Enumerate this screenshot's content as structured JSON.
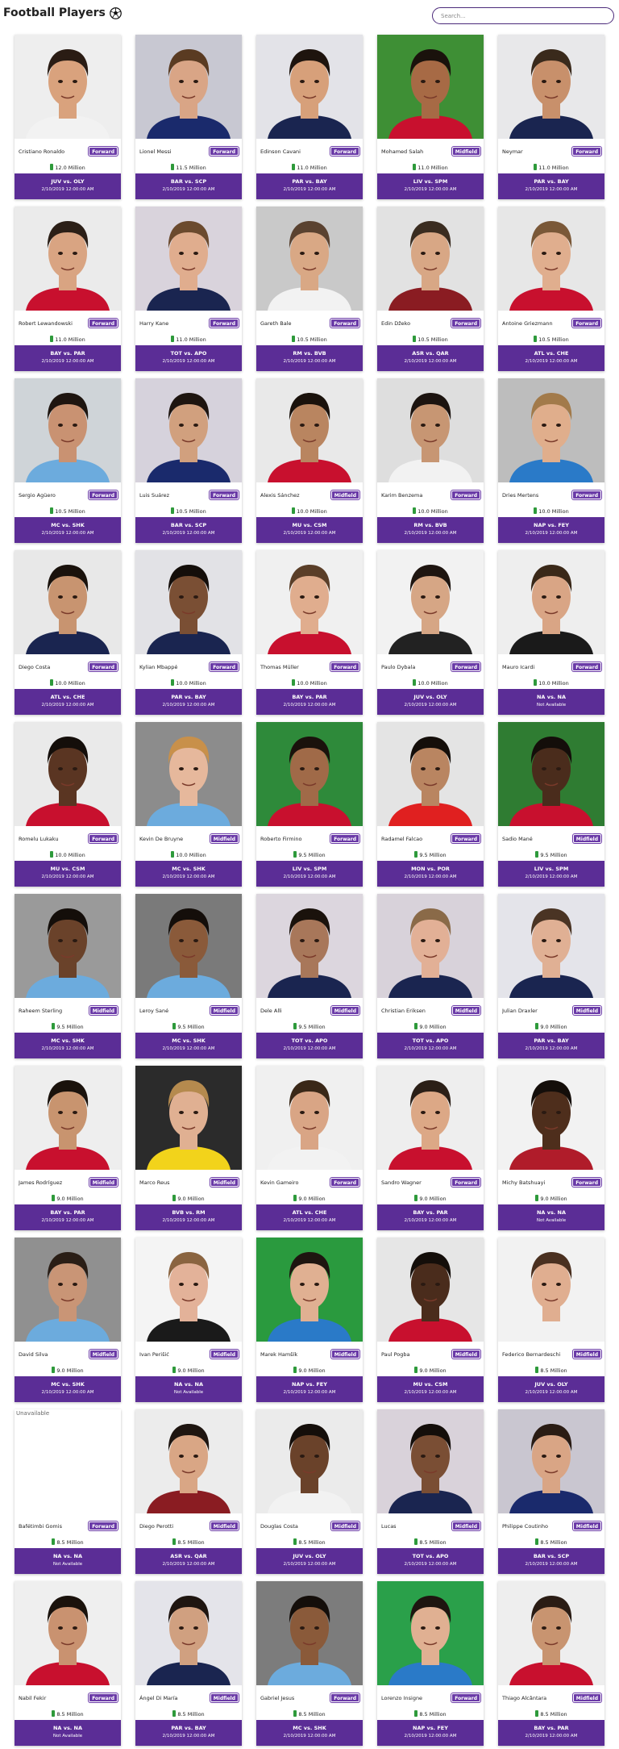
{
  "header": {
    "title": "Football Players",
    "search_placeholder": "Search..."
  },
  "colors": {
    "accent": "#5b2d96",
    "badge": "#6a3aa7",
    "money": "#2e9a3b"
  },
  "icons": {
    "ball": "soccer-ball-icon",
    "money": "money-icon"
  },
  "unavailable_alt": "Unavailable",
  "players": [
    {
      "name": "Cristiano Ronaldo",
      "position": "Forward",
      "value": "12.0 Million",
      "match": "JUV vs. OLY",
      "date": "2/10/2019 12:00:00 AM",
      "bg": "#eeeeee",
      "skin": "#d9a27d",
      "hair": "#2a1c14",
      "shirt": "#f2f2f2"
    },
    {
      "name": "Lionel Messi",
      "position": "Forward",
      "value": "11.5 Million",
      "match": "BAR vs. SCP",
      "date": "2/10/2019 12:00:00 AM",
      "bg": "#c8c8d2",
      "skin": "#d9a586",
      "hair": "#5a3b22",
      "shirt": "#1a2a6c"
    },
    {
      "name": "Edinson Cavani",
      "position": "Forward",
      "value": "11.0 Million",
      "match": "PAR vs. BAY",
      "date": "2/10/2019 12:00:00 AM",
      "bg": "#e3e3e8",
      "skin": "#d7a07a",
      "hair": "#1e140e",
      "shirt": "#1a2550"
    },
    {
      "name": "Mohamed Salah",
      "position": "Midfield",
      "value": "11.0 Million",
      "match": "LIV vs. SPM",
      "date": "2/10/2019 12:00:00 AM",
      "bg": "#3e8f35",
      "skin": "#a76a45",
      "hair": "#1a120c",
      "shirt": "#c8102e"
    },
    {
      "name": "Neymar",
      "position": "Forward",
      "value": "11.0 Million",
      "match": "PAR vs. BAY",
      "date": "2/10/2019 12:00:00 AM",
      "bg": "#e8e8ea",
      "skin": "#c8906b",
      "hair": "#3a2a1c",
      "shirt": "#1a2550"
    },
    {
      "name": "Robert Lewandowski",
      "position": "Forward",
      "value": "11.0 Million",
      "match": "BAY vs. PAR",
      "date": "2/10/2019 12:00:00 AM",
      "bg": "#ebebeb",
      "skin": "#d9a482",
      "hair": "#2b1f17",
      "shirt": "#c8102e"
    },
    {
      "name": "Harry Kane",
      "position": "Forward",
      "value": "11.0 Million",
      "match": "TOT vs. APO",
      "date": "2/10/2019 12:00:00 AM",
      "bg": "#d9d3dc",
      "skin": "#e0ad8e",
      "hair": "#6b4a2e",
      "shirt": "#1a2550"
    },
    {
      "name": "Gareth Bale",
      "position": "Forward",
      "value": "10.5 Million",
      "match": "RM vs. BVB",
      "date": "2/10/2019 12:00:00 AM",
      "bg": "#c9c9c9",
      "skin": "#d9a885",
      "hair": "#5a4230",
      "shirt": "#f2f2f2"
    },
    {
      "name": "Edin Džeko",
      "position": "Forward",
      "value": "10.5 Million",
      "match": "ASR vs. QAR",
      "date": "2/10/2019 12:00:00 AM",
      "bg": "#e2e2e2",
      "skin": "#d8a785",
      "hair": "#3a2c20",
      "shirt": "#8a1c22"
    },
    {
      "name": "Antoine Griezmann",
      "position": "Forward",
      "value": "10.5 Million",
      "match": "ATL vs. CHE",
      "date": "2/10/2019 12:00:00 AM",
      "bg": "#e7e7e7",
      "skin": "#e0ae8e",
      "hair": "#7a5838",
      "shirt": "#c8102e"
    },
    {
      "name": "Sergio Agüero",
      "position": "Forward",
      "value": "10.5 Million",
      "match": "MC vs. SHK",
      "date": "2/10/2019 12:00:00 AM",
      "bg": "#cfd4d8",
      "skin": "#c99272",
      "hair": "#1e1510",
      "shirt": "#6cabdd"
    },
    {
      "name": "Luis Suárez",
      "position": "Forward",
      "value": "10.5 Million",
      "match": "BAR vs. SCP",
      "date": "2/10/2019 12:00:00 AM",
      "bg": "#d6d2dc",
      "skin": "#d1a07e",
      "hair": "#1e1510",
      "shirt": "#1a2a6c"
    },
    {
      "name": "Alexis Sánchez",
      "position": "Midfield",
      "value": "10.0 Million",
      "match": "MU vs. CSM",
      "date": "2/10/2019 12:00:00 AM",
      "bg": "#e9e9e9",
      "skin": "#b98560",
      "hair": "#1a120c",
      "shirt": "#c8102e"
    },
    {
      "name": "Karim Benzema",
      "position": "Forward",
      "value": "10.0 Million",
      "match": "RM vs. BVB",
      "date": "2/10/2019 12:00:00 AM",
      "bg": "#dedede",
      "skin": "#c79673",
      "hair": "#1c1410",
      "shirt": "#f2f2f2"
    },
    {
      "name": "Dries Mertens",
      "position": "Forward",
      "value": "10.0 Million",
      "match": "NAP vs. FEY",
      "date": "2/10/2019 12:00:00 AM",
      "bg": "#bdbdbd",
      "skin": "#e0ae8c",
      "hair": "#a27a4a",
      "shirt": "#2a7ac8"
    },
    {
      "name": "Diego Costa",
      "position": "Forward",
      "value": "10.0 Million",
      "match": "ATL vs. CHE",
      "date": "2/10/2019 12:00:00 AM",
      "bg": "#e8e8e8",
      "skin": "#c89470",
      "hair": "#1a120c",
      "shirt": "#1a2550"
    },
    {
      "name": "Kylian Mbappé",
      "position": "Forward",
      "value": "10.0 Million",
      "match": "PAR vs. BAY",
      "date": "2/10/2019 12:00:00 AM",
      "bg": "#e2e2e6",
      "skin": "#7a4f34",
      "hair": "#140e0a",
      "shirt": "#1a2550"
    },
    {
      "name": "Thomas Müller",
      "position": "Forward",
      "value": "10.0 Million",
      "match": "BAY vs. PAR",
      "date": "2/10/2019 12:00:00 AM",
      "bg": "#f0f0f0",
      "skin": "#e0ad8e",
      "hair": "#5a3e28",
      "shirt": "#c8102e"
    },
    {
      "name": "Paulo Dybala",
      "position": "Forward",
      "value": "10.0 Million",
      "match": "JUV vs. OLY",
      "date": "2/10/2019 12:00:00 AM",
      "bg": "#f2f2f2",
      "skin": "#d6a685",
      "hair": "#1e1510",
      "shirt": "#222222"
    },
    {
      "name": "Mauro Icardi",
      "position": "Forward",
      "value": "10.0 Million",
      "match": "NA vs. NA",
      "date": "Not Available",
      "bg": "#eeeeee",
      "skin": "#d9a585",
      "hair": "#3a2818",
      "shirt": "#1a1a1a"
    },
    {
      "name": "Romelu Lukaku",
      "position": "Forward",
      "value": "10.0 Million",
      "match": "MU vs. CSM",
      "date": "2/10/2019 12:00:00 AM",
      "bg": "#eaeaea",
      "skin": "#5a3522",
      "hair": "#140e0a",
      "shirt": "#c8102e"
    },
    {
      "name": "Kevin De Bruyne",
      "position": "Midfield",
      "value": "10.0 Million",
      "match": "MC vs. SHK",
      "date": "2/10/2019 12:00:00 AM",
      "bg": "#8c8c8c",
      "skin": "#e6b89c",
      "hair": "#c8904a",
      "shirt": "#6cabdd"
    },
    {
      "name": "Roberto Firmino",
      "position": "Forward",
      "value": "9.5 Million",
      "match": "LIV vs. SPM",
      "date": "2/10/2019 12:00:00 AM",
      "bg": "#2e8a3a",
      "skin": "#a06a48",
      "hair": "#1a120c",
      "shirt": "#c8102e"
    },
    {
      "name": "Radamel Falcao",
      "position": "Forward",
      "value": "9.5 Million",
      "match": "MON vs. POR",
      "date": "2/10/2019 12:00:00 AM",
      "bg": "#e4e4e4",
      "skin": "#b98561",
      "hair": "#140e0a",
      "shirt": "#e02020"
    },
    {
      "name": "Sadio Mané",
      "position": "Midfield",
      "value": "9.5 Million",
      "match": "LIV vs. SPM",
      "date": "2/10/2019 12:00:00 AM",
      "bg": "#2f7c32",
      "skin": "#4a2c1c",
      "hair": "#140e0a",
      "shirt": "#c8102e"
    },
    {
      "name": "Raheem Sterling",
      "position": "Midfield",
      "value": "9.5 Million",
      "match": "MC vs. SHK",
      "date": "2/10/2019 12:00:00 AM",
      "bg": "#9a9a9a",
      "skin": "#6a422a",
      "hair": "#140e0a",
      "shirt": "#6cabdd"
    },
    {
      "name": "Leroy Sané",
      "position": "Midfield",
      "value": "9.5 Million",
      "match": "MC vs. SHK",
      "date": "2/10/2019 12:00:00 AM",
      "bg": "#7a7a7a",
      "skin": "#8a5a3a",
      "hair": "#140e0a",
      "shirt": "#6cabdd"
    },
    {
      "name": "Dele Alli",
      "position": "Midfield",
      "value": "9.5 Million",
      "match": "TOT vs. APO",
      "date": "2/10/2019 12:00:00 AM",
      "bg": "#dcd6de",
      "skin": "#a8775a",
      "hair": "#1a120c",
      "shirt": "#1a2550"
    },
    {
      "name": "Christian Eriksen",
      "position": "Midfield",
      "value": "9.0 Million",
      "match": "TOT vs. APO",
      "date": "2/10/2019 12:00:00 AM",
      "bg": "#d8d2da",
      "skin": "#e2b096",
      "hair": "#8a6a48",
      "shirt": "#1a2550"
    },
    {
      "name": "Julian Draxler",
      "position": "Midfield",
      "value": "9.0 Million",
      "match": "PAR vs. BAY",
      "date": "2/10/2019 12:00:00 AM",
      "bg": "#e4e4ea",
      "skin": "#e0b094",
      "hair": "#4a3424",
      "shirt": "#1a2550"
    },
    {
      "name": "James Rodríguez",
      "position": "Midfield",
      "value": "9.0 Million",
      "match": "BAY vs. PAR",
      "date": "2/10/2019 12:00:00 AM",
      "bg": "#eeeeee",
      "skin": "#c8946f",
      "hair": "#1a120c",
      "shirt": "#c8102e"
    },
    {
      "name": "Marco Reus",
      "position": "Midfield",
      "value": "9.0 Million",
      "match": "BVB vs. RM",
      "date": "2/10/2019 12:00:00 AM",
      "bg": "#2b2b2b",
      "skin": "#e0b092",
      "hair": "#b58a4e",
      "shirt": "#f2d31b"
    },
    {
      "name": "Kevin Gameiro",
      "position": "Forward",
      "value": "9.0 Million",
      "match": "ATL vs. CHE",
      "date": "2/10/2019 12:00:00 AM",
      "bg": "#f0f0f0",
      "skin": "#d9a585",
      "hair": "#3a2818",
      "shirt": "#f2f2f2"
    },
    {
      "name": "Sandro Wagner",
      "position": "Forward",
      "value": "9.0 Million",
      "match": "BAY vs. PAR",
      "date": "2/10/2019 12:00:00 AM",
      "bg": "#eeeeee",
      "skin": "#dca886",
      "hair": "#2b1f17",
      "shirt": "#c8102e"
    },
    {
      "name": "Michy Batshuayi",
      "position": "Forward",
      "value": "9.0 Million",
      "match": "NA vs. NA",
      "date": "Not Available",
      "bg": "#f2f2f2",
      "skin": "#4e2e1c",
      "hair": "#140e0a",
      "shirt": "#b01c2a"
    },
    {
      "name": "David Silva",
      "position": "Midfield",
      "value": "9.0 Million",
      "match": "MC vs. SHK",
      "date": "2/10/2019 12:00:00 AM",
      "bg": "#909090",
      "skin": "#c99576",
      "hair": "#2a1e16",
      "shirt": "#6cabdd"
    },
    {
      "name": "Ivan Perišić",
      "position": "Midfield",
      "value": "9.0 Million",
      "match": "NA vs. NA",
      "date": "Not Available",
      "bg": "#f4f4f4",
      "skin": "#e3b299",
      "hair": "#8a6440",
      "shirt": "#1a1a1a"
    },
    {
      "name": "Marek Hamšík",
      "position": "Midfield",
      "value": "9.0 Million",
      "match": "NAP vs. FEY",
      "date": "2/10/2019 12:00:00 AM",
      "bg": "#2a9a3e",
      "skin": "#e0b092",
      "hair": "#1e1510",
      "shirt": "#2a7ac8"
    },
    {
      "name": "Paul Pogba",
      "position": "Midfield",
      "value": "9.0 Million",
      "match": "MU vs. CSM",
      "date": "2/10/2019 12:00:00 AM",
      "bg": "#e6e6e6",
      "skin": "#4a2c1c",
      "hair": "#140e0a",
      "shirt": "#c8102e"
    },
    {
      "name": "Federico Bernardeschi",
      "position": "Midfield",
      "value": "8.5 Million",
      "match": "JUV vs. OLY",
      "date": "2/10/2019 12:00:00 AM",
      "bg": "#f2f2f2",
      "skin": "#e0ae90",
      "hair": "#4a3020",
      "shirt": "#f2f2f2"
    },
    {
      "name": "Bafétimbi Gomis",
      "position": "Forward",
      "value": "8.5 Million",
      "match": "NA vs. NA",
      "date": "Not Available",
      "unavailable": true
    },
    {
      "name": "Diego Perotti",
      "position": "Midfield",
      "value": "8.5 Million",
      "match": "ASR vs. QAR",
      "date": "2/10/2019 12:00:00 AM",
      "bg": "#ececec",
      "skin": "#d9a685",
      "hair": "#1e1510",
      "shirt": "#8a1c22"
    },
    {
      "name": "Douglas Costa",
      "position": "Midfield",
      "value": "8.5 Million",
      "match": "JUV vs. OLY",
      "date": "2/10/2019 12:00:00 AM",
      "bg": "#ebebeb",
      "skin": "#6a422a",
      "hair": "#140e0a",
      "shirt": "#f2f2f2"
    },
    {
      "name": "Lucas",
      "position": "Midfield",
      "value": "8.5 Million",
      "match": "TOT vs. APO",
      "date": "2/10/2019 12:00:00 AM",
      "bg": "#d9d2da",
      "skin": "#7a4e34",
      "hair": "#140e0a",
      "shirt": "#1a2550"
    },
    {
      "name": "Philippe Coutinho",
      "position": "Midfield",
      "value": "8.5 Million",
      "match": "BAR vs. SCP",
      "date": "2/10/2019 12:00:00 AM",
      "bg": "#c9c6d0",
      "skin": "#d9a585",
      "hair": "#2a1c14",
      "shirt": "#1a2a6c"
    },
    {
      "name": "Nabil Fekir",
      "position": "Forward",
      "value": "8.5 Million",
      "match": "NA vs. NA",
      "date": "Not Available",
      "bg": "#efefef",
      "skin": "#c99270",
      "hair": "#1a120c",
      "shirt": "#c8102e"
    },
    {
      "name": "Ángel Di María",
      "position": "Midfield",
      "value": "8.5 Million",
      "match": "PAR vs. BAY",
      "date": "2/10/2019 12:00:00 AM",
      "bg": "#e4e4ea",
      "skin": "#d0a080",
      "hair": "#1e1510",
      "shirt": "#1a2550"
    },
    {
      "name": "Gabriel Jesus",
      "position": "Forward",
      "value": "8.5 Million",
      "match": "MC vs. SHK",
      "date": "2/10/2019 12:00:00 AM",
      "bg": "#7c7c7c",
      "skin": "#8a5a3a",
      "hair": "#140e0a",
      "shirt": "#6cabdd"
    },
    {
      "name": "Lorenzo Insigne",
      "position": "Forward",
      "value": "8.5 Million",
      "match": "NAP vs. FEY",
      "date": "2/10/2019 12:00:00 AM",
      "bg": "#2aa04a",
      "skin": "#e0b092",
      "hair": "#1e1510",
      "shirt": "#2a7ac8"
    },
    {
      "name": "Thiago Alcântara",
      "position": "Midfield",
      "value": "8.5 Million",
      "match": "BAY vs. PAR",
      "date": "2/10/2019 12:00:00 AM",
      "bg": "#eeeeee",
      "skin": "#c89470",
      "hair": "#2a1c14",
      "shirt": "#c8102e"
    }
  ]
}
